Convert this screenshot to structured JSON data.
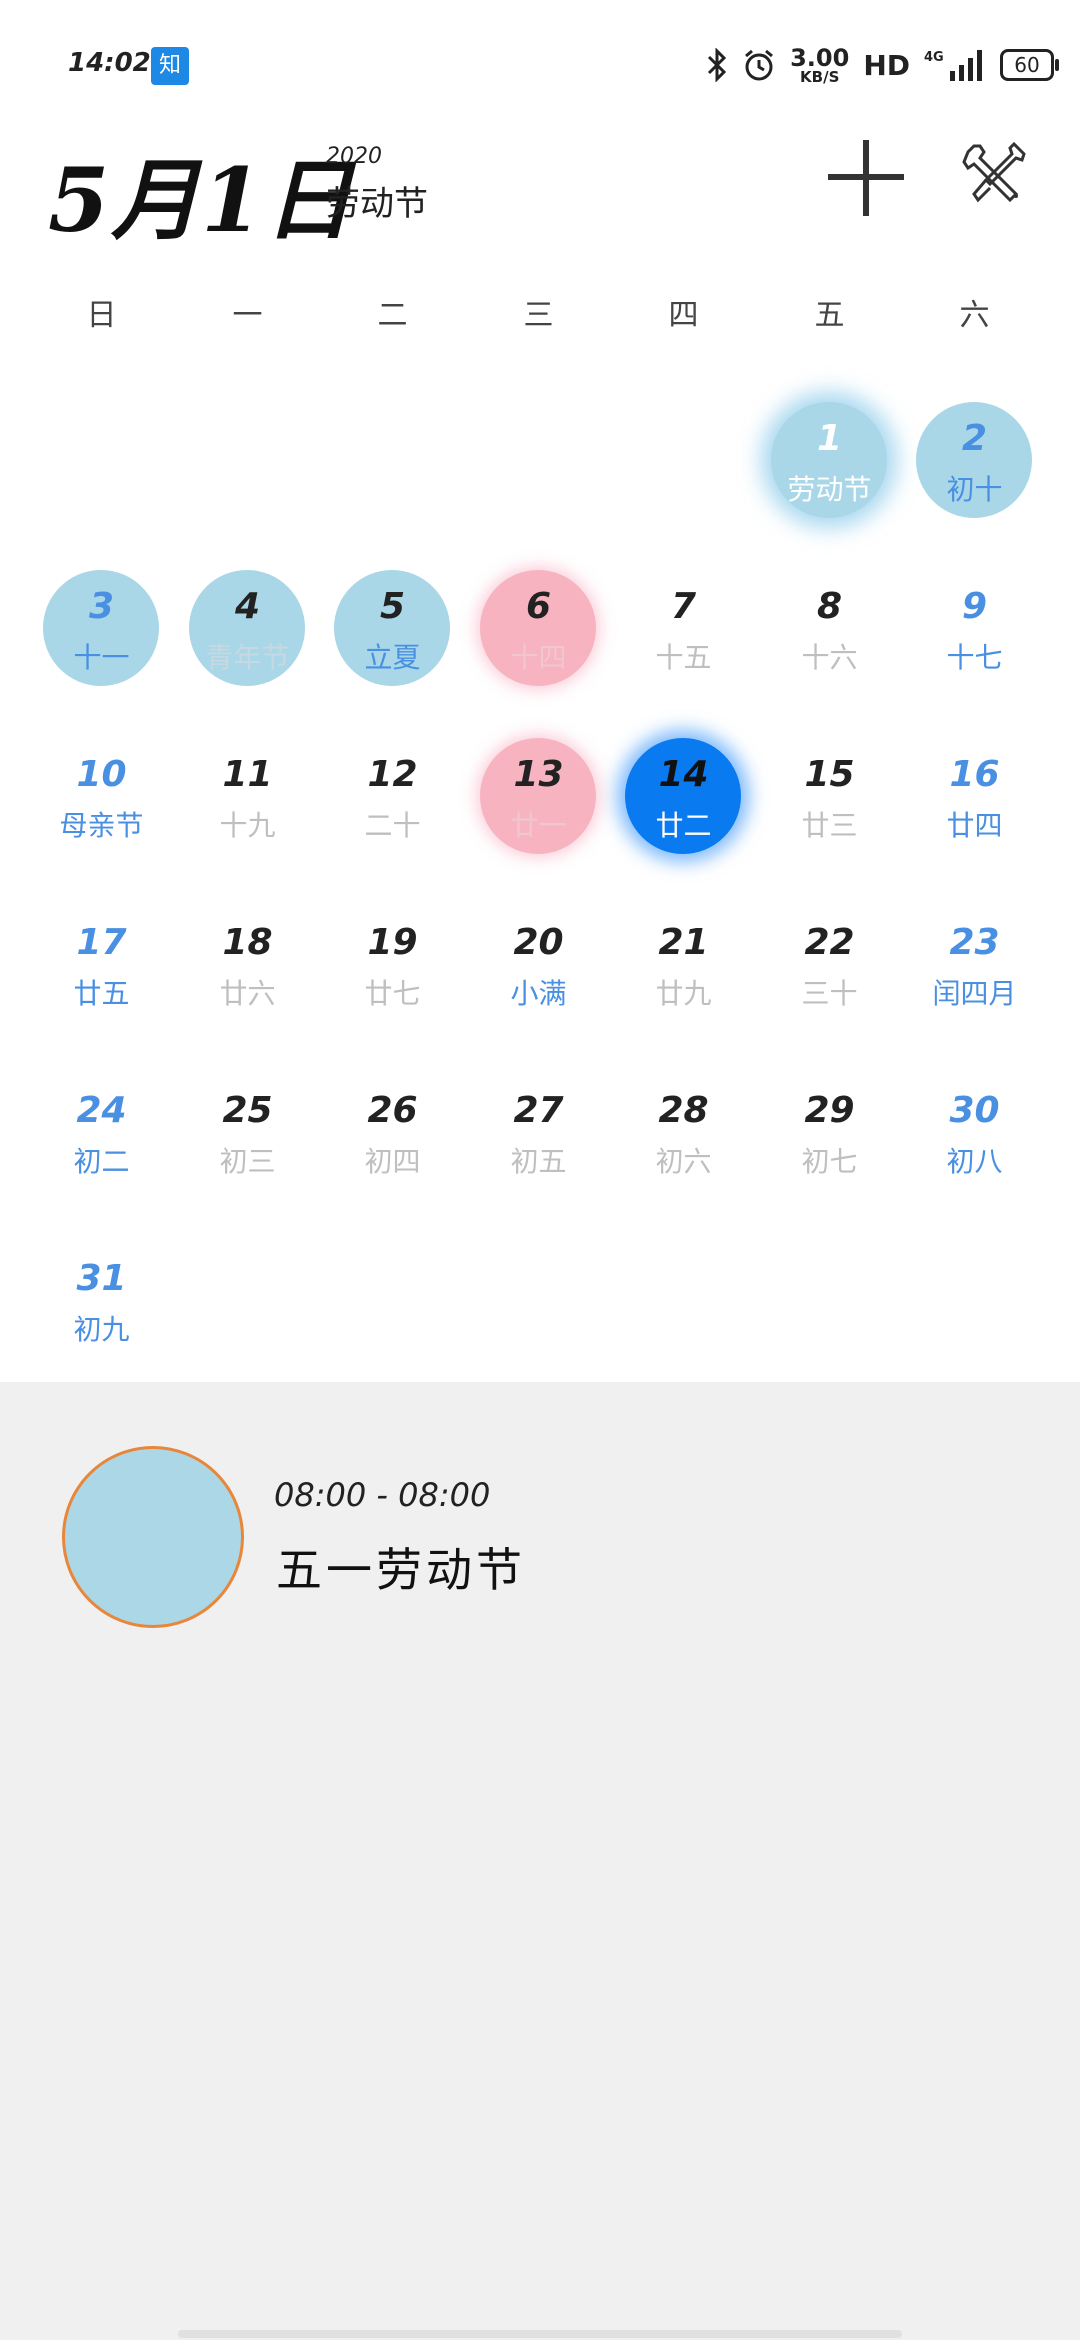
{
  "status_bar": {
    "time": "14:02",
    "app_badge": "知",
    "net_speed_value": "3.00",
    "net_speed_unit": "KB/S",
    "hd_label": "HD",
    "network_label": "4G",
    "battery": "60",
    "icons": [
      "bluetooth-icon",
      "alarm-icon",
      "signal-icon",
      "battery-icon"
    ]
  },
  "header": {
    "date": "5月1日",
    "year": "2020",
    "holiday": "劳动节"
  },
  "weekdays": [
    "日",
    "一",
    "二",
    "三",
    "四",
    "五",
    "六"
  ],
  "calendar": {
    "days": [
      {
        "d": "1",
        "l": "劳动节"
      },
      {
        "d": "2",
        "l": "初十"
      },
      {
        "d": "3",
        "l": "十一"
      },
      {
        "d": "4",
        "l": "青年节"
      },
      {
        "d": "5",
        "l": "立夏"
      },
      {
        "d": "6",
        "l": "十四"
      },
      {
        "d": "7",
        "l": "十五"
      },
      {
        "d": "8",
        "l": "十六"
      },
      {
        "d": "9",
        "l": "十七"
      },
      {
        "d": "10",
        "l": "母亲节"
      },
      {
        "d": "11",
        "l": "十九"
      },
      {
        "d": "12",
        "l": "二十"
      },
      {
        "d": "13",
        "l": "廿一"
      },
      {
        "d": "14",
        "l": "廿二"
      },
      {
        "d": "15",
        "l": "廿三"
      },
      {
        "d": "16",
        "l": "廿四"
      },
      {
        "d": "17",
        "l": "廿五"
      },
      {
        "d": "18",
        "l": "廿六"
      },
      {
        "d": "19",
        "l": "廿七"
      },
      {
        "d": "20",
        "l": "小满"
      },
      {
        "d": "21",
        "l": "廿九"
      },
      {
        "d": "22",
        "l": "三十"
      },
      {
        "d": "23",
        "l": "闰四月"
      },
      {
        "d": "24",
        "l": "初二"
      },
      {
        "d": "25",
        "l": "初三"
      },
      {
        "d": "26",
        "l": "初四"
      },
      {
        "d": "27",
        "l": "初五"
      },
      {
        "d": "28",
        "l": "初六"
      },
      {
        "d": "29",
        "l": "初七"
      },
      {
        "d": "30",
        "l": "初八"
      },
      {
        "d": "31",
        "l": "初九"
      }
    ]
  },
  "event": {
    "time": "08:00 - 08:00",
    "title": "五一劳动节"
  },
  "colors": {
    "accent": "#0a7af0",
    "weekend": "#4a90e2",
    "holiday_circle": "#a9d7e8",
    "workday_circle": "#f8b3c1",
    "event_dot_border": "#e8863a",
    "event_bg": "#f0f0f0"
  }
}
